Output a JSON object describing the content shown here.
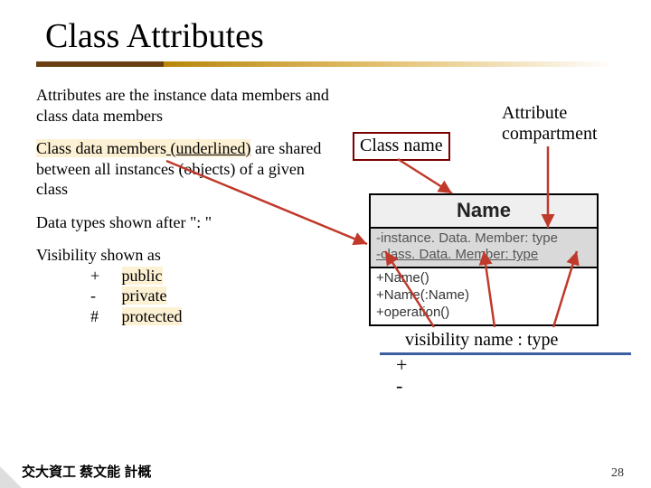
{
  "title": "Class Attributes",
  "para1": "Attributes are the instance data members and class data members",
  "para2_a": "Class data members",
  "para2_b": " (underlined)",
  "para2_c": " are shared between all instances (objects) of a given class",
  "para3": "Data types shown after \": \"",
  "vis_heading": "Visibility shown as",
  "vis_rows": [
    {
      "sym": "+",
      "word": "public"
    },
    {
      "sym": "-",
      "word": "private"
    },
    {
      "sym": "#",
      "word": "protected"
    }
  ],
  "uml": {
    "name": "Name",
    "attr1": "-instance. Data. Member: type",
    "attr2": "-class. Data. Member: type",
    "ops": [
      "+Name()",
      "+Name(:Name)",
      "+operation()"
    ]
  },
  "labels": {
    "classname": "Class name",
    "attr_line1": "Attribute",
    "attr_line2": "compartment",
    "vistype": "visibility name : type",
    "plus": "+",
    "minus": "-"
  },
  "footer_left": "交大資工 蔡文能 計概",
  "page_no": "28"
}
